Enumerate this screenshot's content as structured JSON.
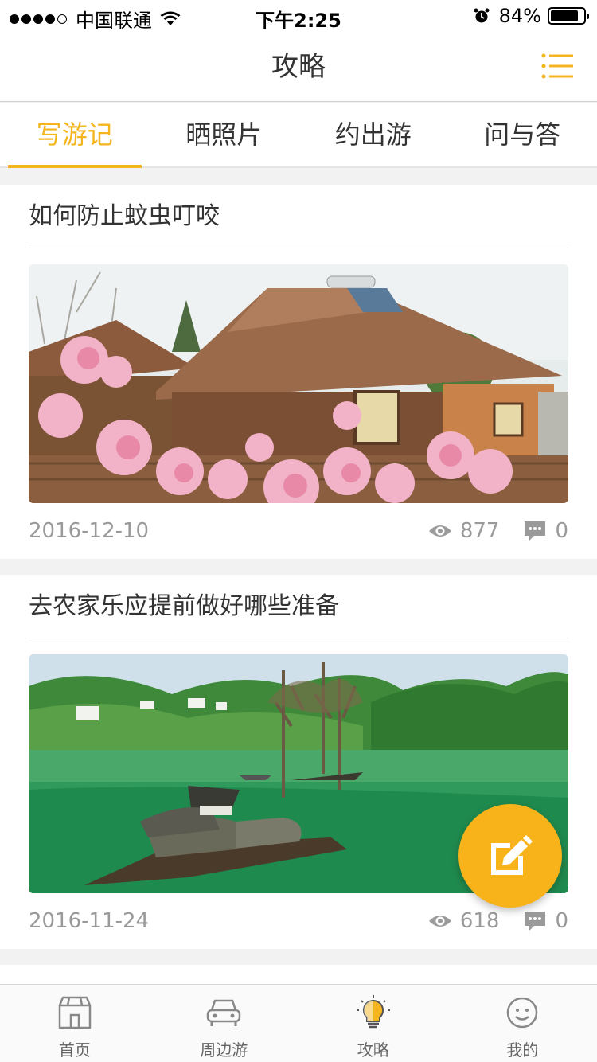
{
  "status_bar": {
    "carrier": "中国联通",
    "time": "下午2:25",
    "battery_text": "84%",
    "battery_level": 0.84
  },
  "nav": {
    "title": "攻略",
    "menu_icon": "list-menu-icon"
  },
  "tabs": [
    {
      "label": "写游记",
      "active": true
    },
    {
      "label": "晒照片",
      "active": false
    },
    {
      "label": "约出游",
      "active": false
    },
    {
      "label": "问与答",
      "active": false
    }
  ],
  "posts": [
    {
      "title": "如何防止蚊虫叮咬",
      "image": "wooden-house-peach-blossom",
      "date": "2016-12-10",
      "views": "877",
      "comments": "0"
    },
    {
      "title": "去农家乐应提前做好哪些准备",
      "image": "lake-boats-green-hills",
      "date": "2016-11-24",
      "views": "618",
      "comments": "0"
    }
  ],
  "fab": {
    "icon": "edit-icon"
  },
  "tabbar": [
    {
      "label": "首页",
      "icon": "home-icon"
    },
    {
      "label": "周边游",
      "icon": "car-icon"
    },
    {
      "label": "攻略",
      "icon": "lightbulb-icon"
    },
    {
      "label": "我的",
      "icon": "smiley-icon"
    }
  ],
  "colors": {
    "accent": "#f5b51e",
    "text": "#333333",
    "muted": "#9a9a9a"
  }
}
